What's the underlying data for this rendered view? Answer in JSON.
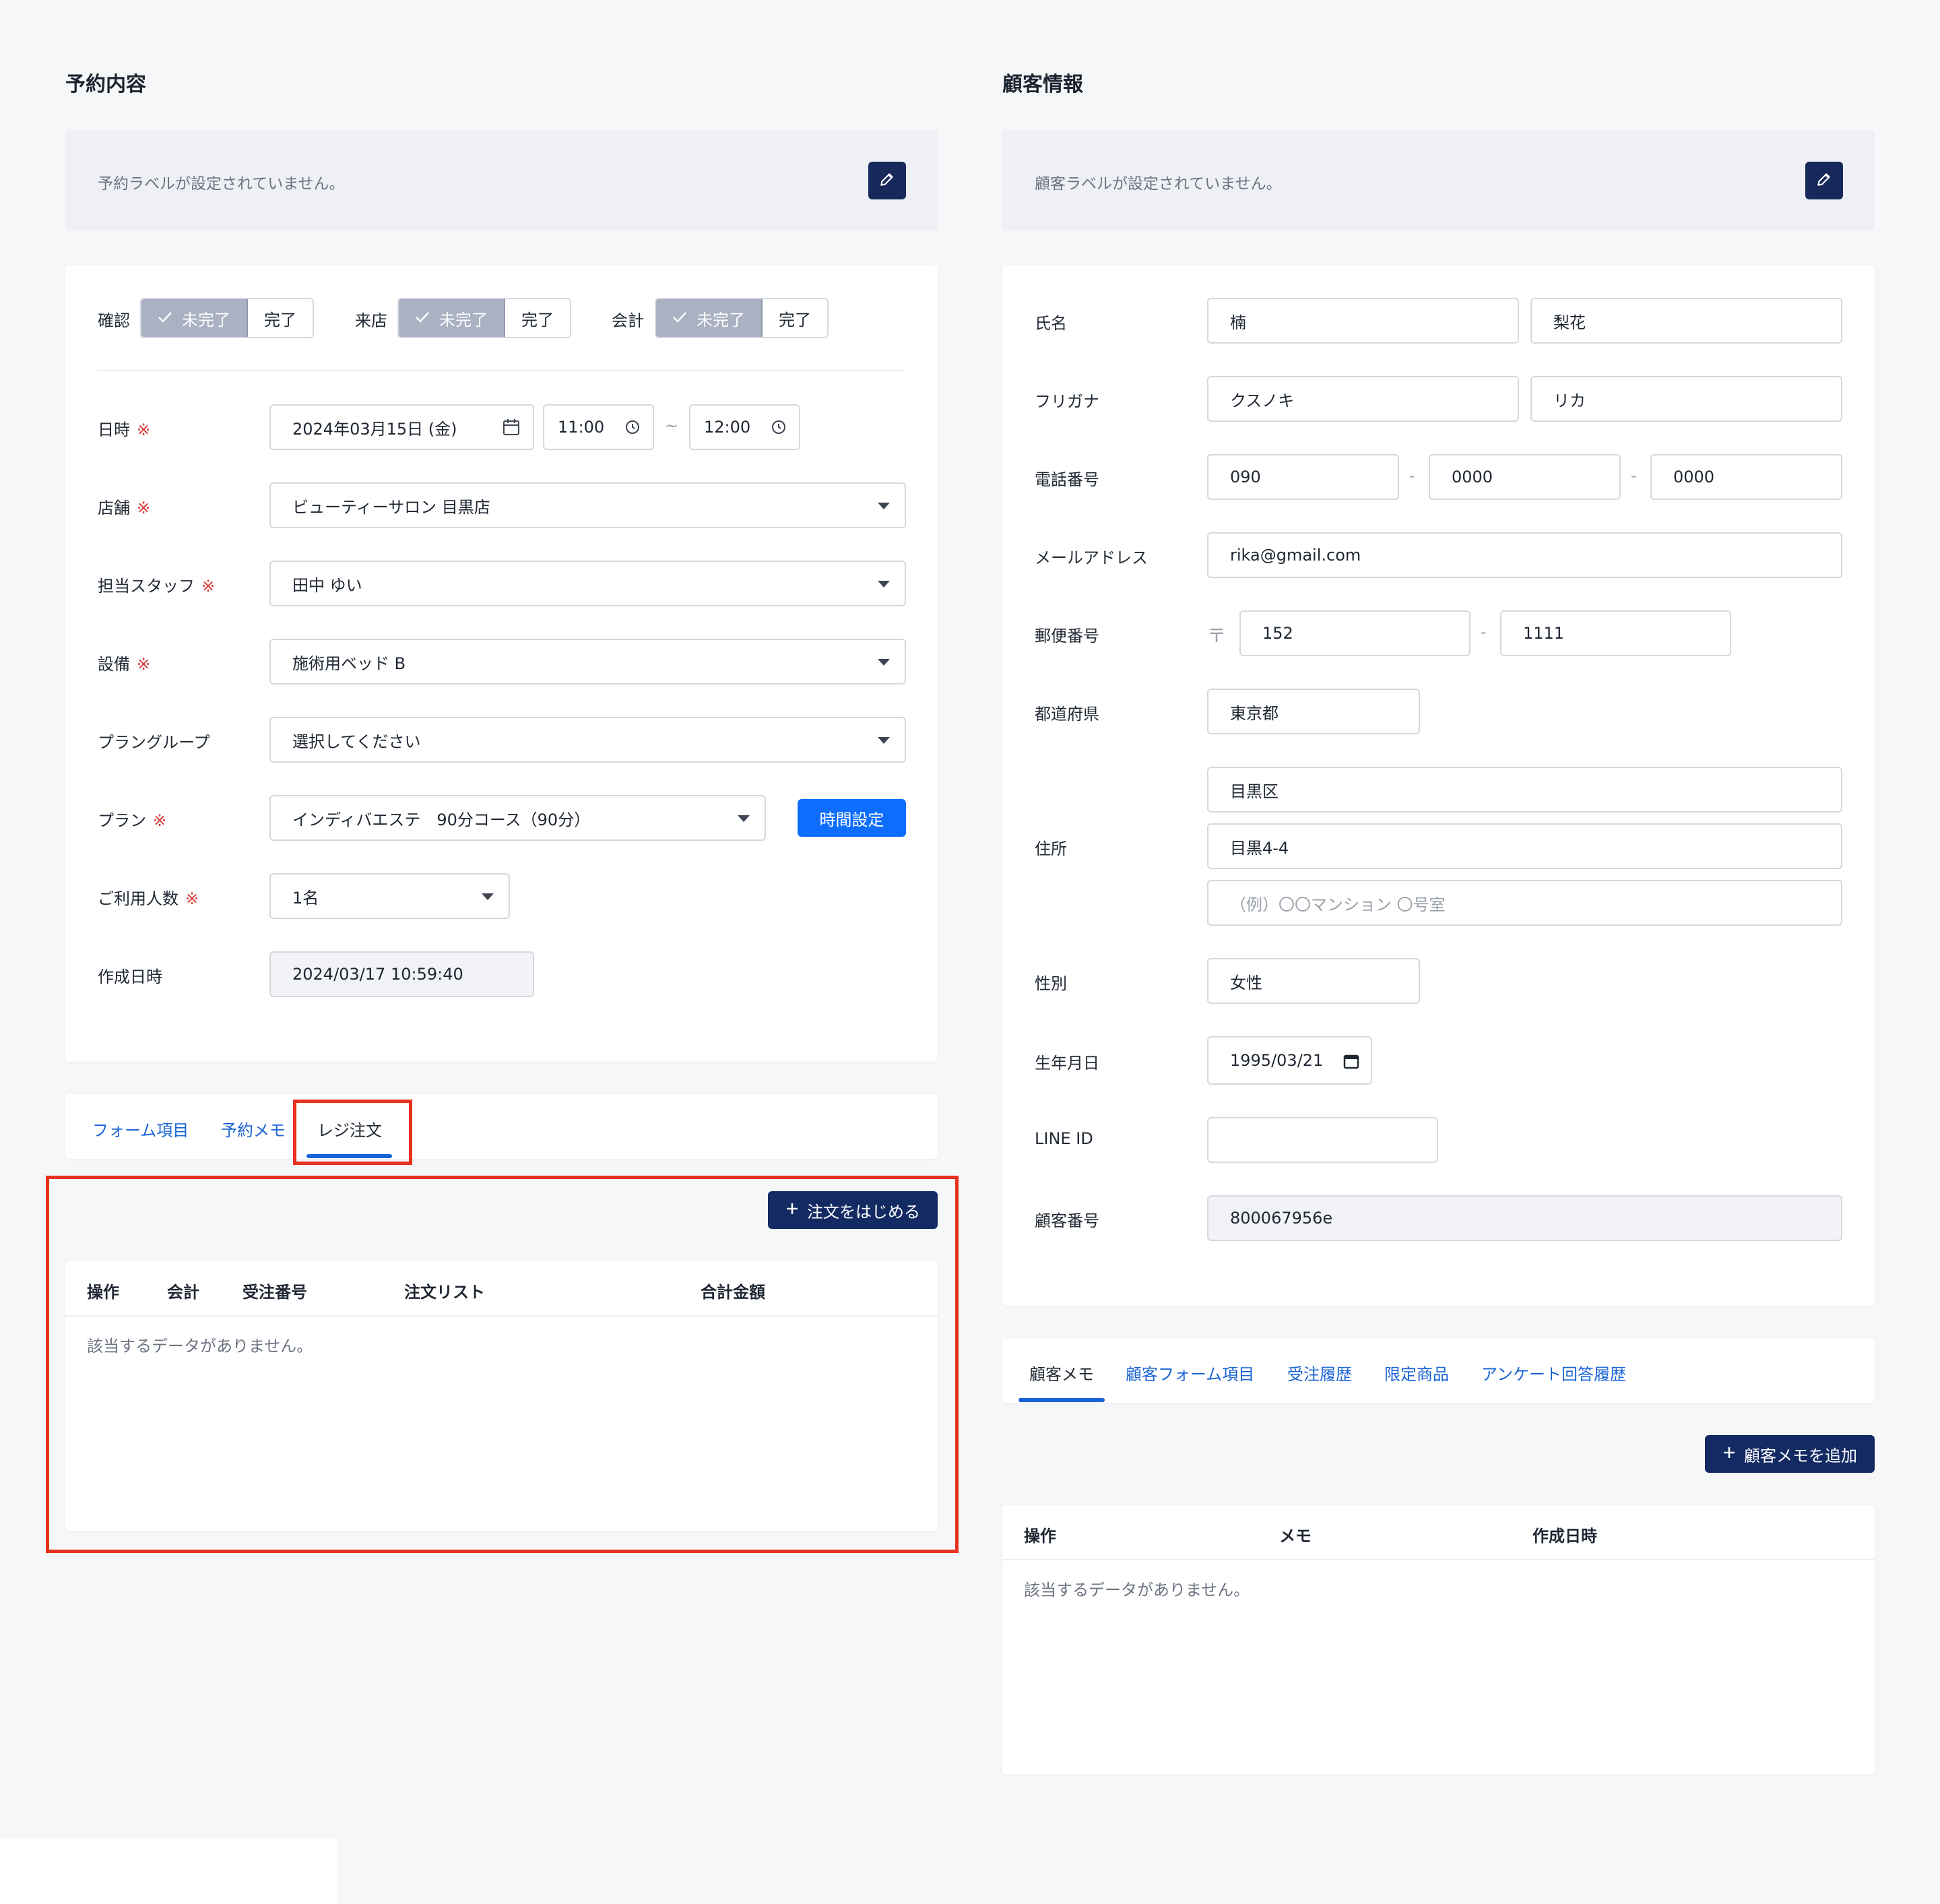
{
  "reservation": {
    "title": "予約内容",
    "label_empty": "予約ラベルが設定されていません。",
    "status": {
      "confirm": {
        "label": "確認",
        "incomplete": "未完了",
        "complete": "完了"
      },
      "visit": {
        "label": "来店",
        "incomplete": "未完了",
        "complete": "完了"
      },
      "payment": {
        "label": "会計",
        "incomplete": "未完了",
        "complete": "完了"
      }
    },
    "required_mark": "※",
    "datetime": {
      "label": "日時",
      "date": "2024年03月15日 (金)",
      "start": "11:00",
      "tilde": "~",
      "end": "12:00"
    },
    "store": {
      "label": "店舗",
      "value": "ビューティーサロン 目黒店"
    },
    "staff": {
      "label": "担当スタッフ",
      "value": "田中 ゆい"
    },
    "equipment": {
      "label": "設備",
      "value": "施術用ベッド B"
    },
    "plan_group": {
      "label": "プラングループ",
      "value": "選択してください"
    },
    "plan": {
      "label": "プラン",
      "value": "インディバエステ　90分コース（90分）",
      "time_button": "時間設定"
    },
    "guests": {
      "label": "ご利用人数",
      "value": "1名"
    },
    "created": {
      "label": "作成日時",
      "value": "2024/03/17 10:59:40"
    },
    "tabs": [
      "フォーム項目",
      "予約メモ",
      "レジ注文"
    ],
    "active_tab": "レジ注文",
    "order_button": "注文をはじめる",
    "order_table": {
      "headers": [
        "操作",
        "会計",
        "受注番号",
        "注文リスト",
        "合計金額"
      ],
      "empty": "該当するデータがありません。"
    }
  },
  "customer": {
    "title": "顧客情報",
    "label_empty": "顧客ラベルが設定されていません。",
    "name": {
      "label": "氏名",
      "last": "楠",
      "first": "梨花"
    },
    "kana": {
      "label": "フリガナ",
      "last": "クスノキ",
      "first": "リカ"
    },
    "phone": {
      "label": "電話番号",
      "p1": "090",
      "p2": "0000",
      "p3": "0000",
      "sep": "-"
    },
    "email": {
      "label": "メールアドレス",
      "value": "rika@gmail.com"
    },
    "postal": {
      "label": "郵便番号",
      "mark": "〒",
      "p1": "152",
      "p2": "1111",
      "sep": "-"
    },
    "prefecture": {
      "label": "都道府県",
      "value": "東京都"
    },
    "address": {
      "label": "住所",
      "line1": "目黒区",
      "line2": "目黒4-4",
      "line3_placeholder": "（例）〇〇マンション 〇号室"
    },
    "gender": {
      "label": "性別",
      "value": "女性"
    },
    "birthday": {
      "label": "生年月日",
      "value": "1995/03/21"
    },
    "line_id": {
      "label": "LINE ID",
      "value": ""
    },
    "customer_no": {
      "label": "顧客番号",
      "value": "800067956e"
    },
    "tabs": [
      "顧客メモ",
      "顧客フォーム項目",
      "受注履歴",
      "限定商品",
      "アンケート回答履歴"
    ],
    "active_tab": "顧客メモ",
    "memo_button": "顧客メモを追加",
    "memo_table": {
      "headers": [
        "操作",
        "メモ",
        "作成日時"
      ],
      "empty": "該当するデータがありません。"
    }
  },
  "colors": {
    "accent_blue": "#0d6efd",
    "navy": "#132a63",
    "highlight_red": "#e8321f"
  },
  "icons": [
    "pencil-icon",
    "check-icon",
    "calendar-icon",
    "clock-icon",
    "chevron-down-icon",
    "plus-icon"
  ]
}
